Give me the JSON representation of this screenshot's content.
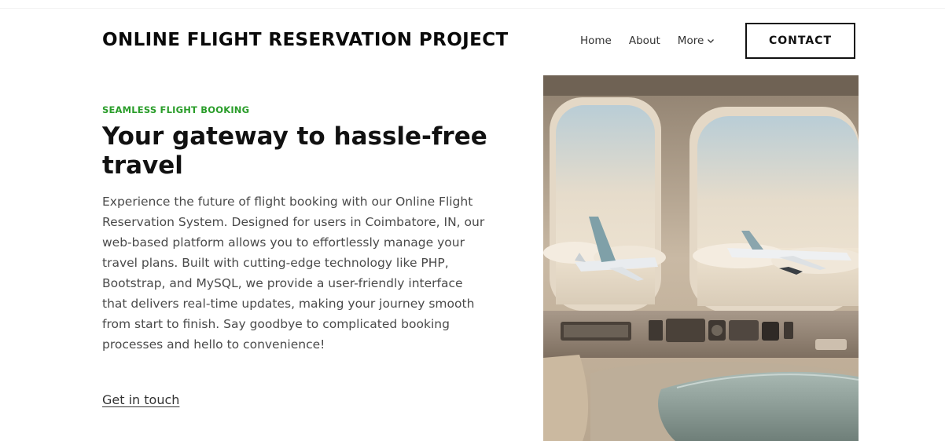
{
  "header": {
    "site_title": "ONLINE FLIGHT RESERVATION PROJECT",
    "nav": {
      "home": "Home",
      "about": "About",
      "more": "More",
      "more_icon": "chevron-down-icon"
    },
    "contact_label": "CONTACT"
  },
  "hero": {
    "eyebrow": "SEAMLESS FLIGHT BOOKING",
    "headline": "Your gateway to hassle-free travel",
    "body": "Experience the future of flight booking with our Online Flight Reservation System. Designed for users in Coimbatore, IN, our web-based platform allows you to effortlessly manage your travel plans. Built with cutting-edge technology like PHP, Bootstrap, and MySQL, we provide a user-friendly interface that delivers real-time updates, making your journey smooth from start to finish. Say goodbye to complicated booking processes and hello to convenience!",
    "cta": "Get in touch",
    "image_subject": "airplane cabin windows with airliners flying over clouds"
  },
  "colors": {
    "accent": "#2a9d2a",
    "text_dark": "#111111",
    "text_body": "#4a4a4a"
  }
}
